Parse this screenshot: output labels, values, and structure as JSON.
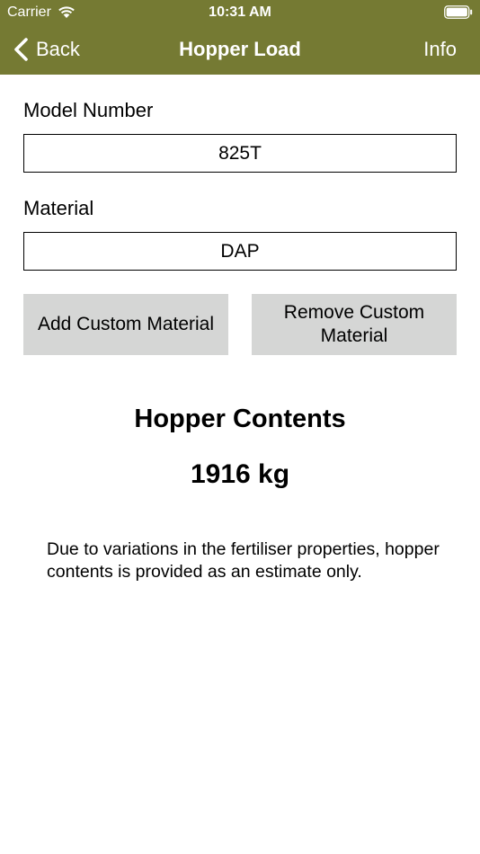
{
  "status_bar": {
    "carrier": "Carrier",
    "time": "10:31 AM"
  },
  "nav": {
    "back_label": "Back",
    "title": "Hopper Load",
    "info_label": "Info"
  },
  "form": {
    "model_label": "Model Number",
    "model_value": "825T",
    "material_label": "Material",
    "material_value": "DAP"
  },
  "buttons": {
    "add_custom": "Add Custom Material",
    "remove_custom": "Remove Custom Material"
  },
  "result": {
    "title": "Hopper Contents",
    "value": "1916 kg"
  },
  "disclaimer": "Due to variations in the fertiliser properties, hopper contents is provided as an estimate only.",
  "colors": {
    "header_bg": "#757a33",
    "button_bg": "#d5d6d5"
  }
}
